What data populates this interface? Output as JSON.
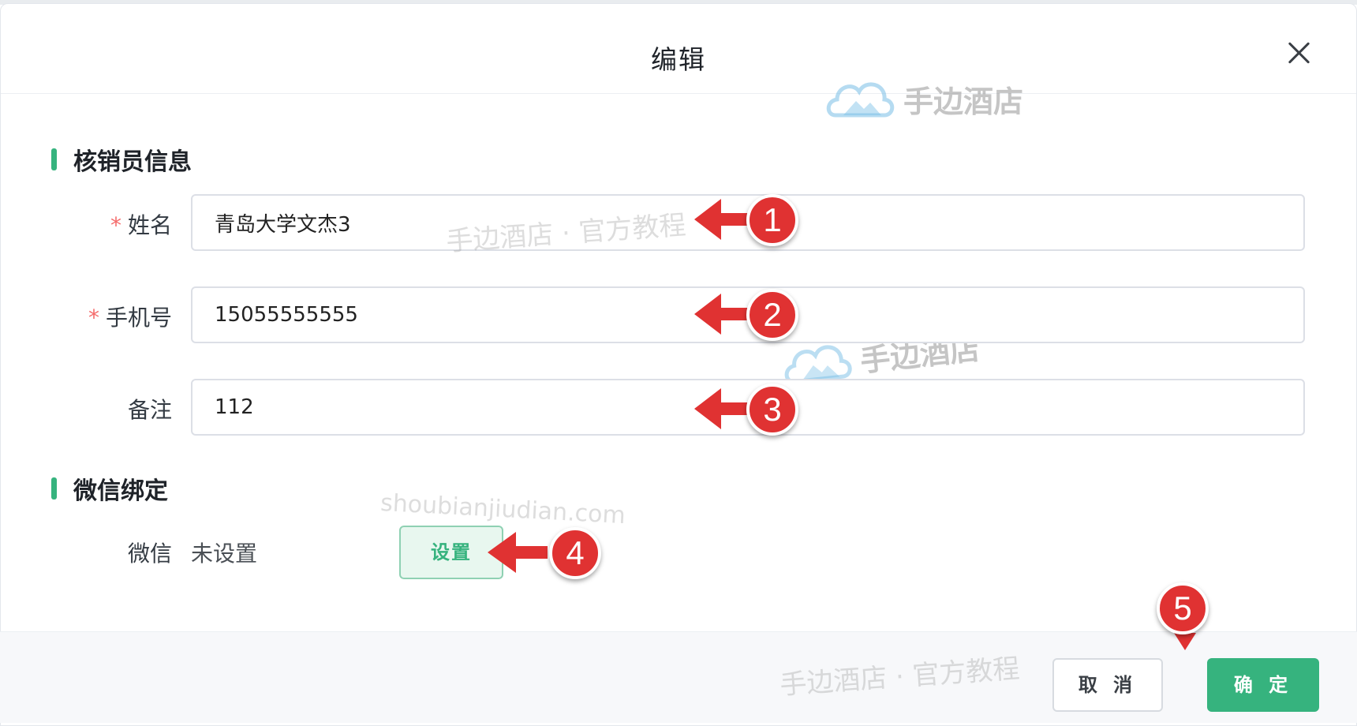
{
  "dialog": {
    "title": "编辑",
    "close_icon": "close-icon"
  },
  "section_info": {
    "title": "核销员信息"
  },
  "fields": {
    "name": {
      "label": "姓名",
      "required_mark": "*",
      "value": "青岛大学文杰3"
    },
    "phone": {
      "label": "手机号",
      "required_mark": "*",
      "value": "15055555555"
    },
    "note": {
      "label": "备注",
      "value": "112"
    }
  },
  "section_wechat": {
    "title": "微信绑定"
  },
  "wechat": {
    "label": "微信",
    "value": "未设置",
    "set_label": "设置"
  },
  "footer": {
    "cancel_label": "取 消",
    "ok_label": "确 定"
  },
  "watermarks": {
    "brand": "手边酒店",
    "brand2": "手边酒店",
    "tutorial1": "手边酒店 · 官方教程",
    "tutorial2": "手边酒店 · 官方教程",
    "domain": "shoubianjiudian.com"
  },
  "callouts": [
    "1",
    "2",
    "3",
    "4",
    "5"
  ],
  "colors": {
    "accent": "#36b37e",
    "callout": "#e03232",
    "required": "#f56c6c"
  }
}
